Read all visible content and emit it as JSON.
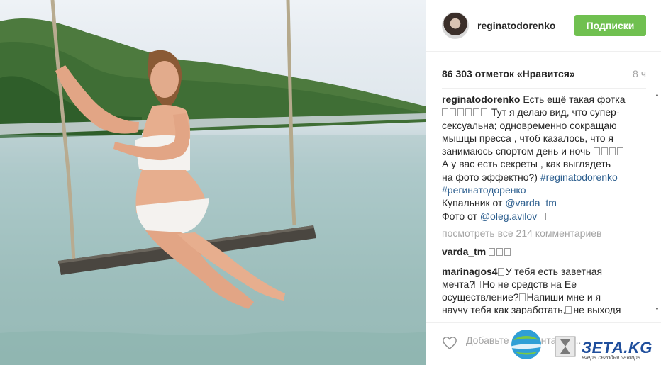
{
  "post": {
    "username": "reginatodorenko",
    "follow_label": "Подписки",
    "likes_text": "86 303 отметок «Нравится»",
    "time_ago": "8 ч",
    "caption_author": "reginatodorenko",
    "caption_lines": {
      "l1": "Есть ещё такая фотка",
      "l2": "Тут я делаю вид, что супер-",
      "l3": "сексуальна; одновременно сокращаю",
      "l4": "мышцы пресса , чтоб казалось, что я",
      "l5": "занимаюсь спортом день и ночь",
      "l6": "А у вас есть секреты , как выглядеть",
      "l7": "на фото эффектно?)",
      "hashtag1": "#reginatodorenko",
      "hashtag2": "#регинатодоренко",
      "swimsuit_prefix": "Купальник от",
      "swimsuit_tag": "@varda_tm",
      "photo_prefix": "Фото от",
      "photo_tag": "@oleg.avilov"
    },
    "view_all_comments": "посмотреть все 214 комментариев",
    "comments": [
      {
        "user": "varda_tm",
        "text": ""
      },
      {
        "user": "marinagos4",
        "text_l1": "У тебя есть заветная",
        "text_l2": "мечта?",
        "text_l2b": "Но не средств на Ее",
        "text_l3": "осуществление?",
        "text_l3b": "Напиши мне и я",
        "text_l4": "научу тебя как заработать,",
        "text_l4b": "не выходя"
      }
    ],
    "add_comment_placeholder": "Добавьте комментарий...",
    "more_icon": "ellipsis-icon"
  },
  "watermark": {
    "brand": "ЗЕТА.KG",
    "slogan": "вчера сегодня завтра"
  },
  "colors": {
    "follow_bg": "#70c050",
    "link": "#2d5f8f",
    "muted": "#a5a5a5"
  }
}
